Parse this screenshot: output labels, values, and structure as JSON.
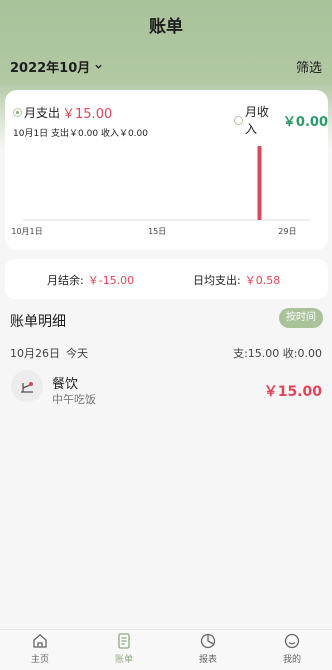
{
  "header": {
    "title": "账单",
    "month": "2022年10月",
    "filter_label": "筛选"
  },
  "summary": {
    "expense_label": "月支出",
    "expense_value": "￥15.00",
    "income_label": "月收入",
    "income_value": "￥0.00",
    "day_info": "10月1日  支出￥0.00  收入￥0.00"
  },
  "chart_data": {
    "type": "bar",
    "title": "",
    "xlabel": "",
    "ylabel": "",
    "tick_labels": [
      "10月1日",
      "15日",
      "29日"
    ],
    "x": [
      1,
      2,
      3,
      4,
      5,
      6,
      7,
      8,
      9,
      10,
      11,
      12,
      13,
      14,
      15,
      16,
      17,
      18,
      19,
      20,
      21,
      22,
      23,
      24,
      25,
      26,
      27,
      28,
      29,
      30,
      31
    ],
    "values": [
      0,
      0,
      0,
      0,
      0,
      0,
      0,
      0,
      0,
      0,
      0,
      0,
      0,
      0,
      0,
      0,
      0,
      0,
      0,
      0,
      0,
      0,
      0,
      0,
      0,
      15,
      0,
      0,
      0,
      0,
      0
    ],
    "ylim": [
      0,
      15
    ],
    "bar_color": "#e0465a",
    "grid": false
  },
  "stats": {
    "balance_label": "月结余:",
    "balance_value": "￥-15.00",
    "daily_avg_label": "日均支出:",
    "daily_avg_value": "￥0.58"
  },
  "details": {
    "title": "账单明细",
    "sort_label": "按时间",
    "date": "10月26日",
    "weekday": "今天",
    "day_totals": "支:15.00  收:0.00",
    "records": [
      {
        "category": "餐饮",
        "note": "中午吃饭",
        "amount": "￥15.00",
        "icon": "dining-icon"
      }
    ]
  },
  "tabs": [
    {
      "label": "主页",
      "icon": "home-icon"
    },
    {
      "label": "账单",
      "icon": "bill-icon"
    },
    {
      "label": "报表",
      "icon": "pie-chart-icon"
    },
    {
      "label": "我的",
      "icon": "smiley-icon"
    }
  ],
  "colors": {
    "accent": "#a9c29a",
    "expense": "#e0465a",
    "income": "#2e9a6a"
  }
}
